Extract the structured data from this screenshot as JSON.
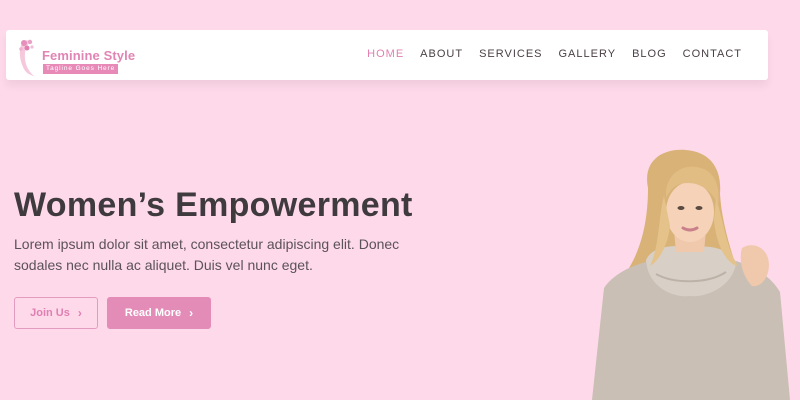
{
  "brand": {
    "name": "Feminine Style",
    "tagline": "Tagline Goes Here",
    "accent": "#e17fb0",
    "background": "#fed9ea"
  },
  "nav": {
    "items": [
      {
        "label": "HOME",
        "active": true
      },
      {
        "label": "ABOUT",
        "active": false
      },
      {
        "label": "SERVICES",
        "active": false
      },
      {
        "label": "GALLERY",
        "active": false
      },
      {
        "label": "BLOG",
        "active": false
      },
      {
        "label": "CONTACT",
        "active": false
      }
    ]
  },
  "hero": {
    "title": "Women’s Empowerment",
    "text": "Lorem ipsum dolor sit amet, consectetur adipiscing elit. Donec sodales nec nulla ac aliquet. Duis vel nunc eget.",
    "buttons": {
      "join_label": "Join Us",
      "read_label": "Read More",
      "icon": "chevron-right-icon"
    }
  }
}
